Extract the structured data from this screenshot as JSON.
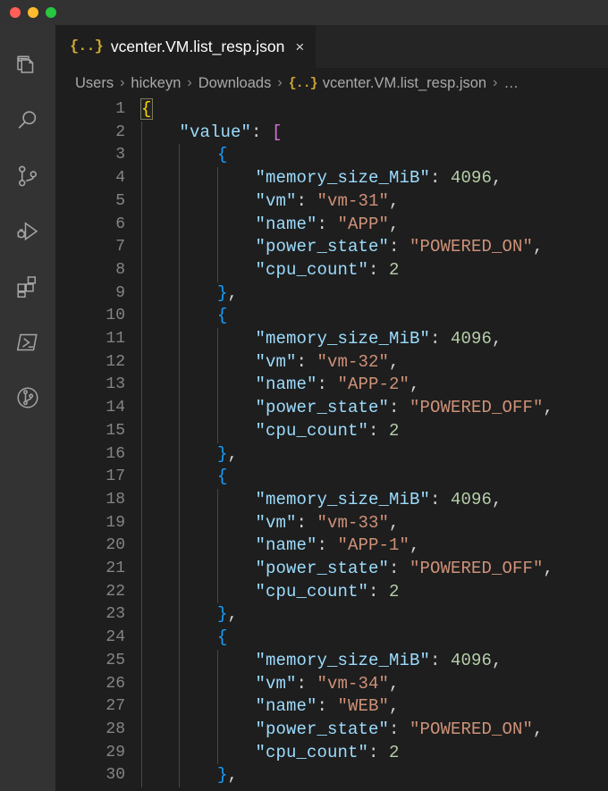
{
  "window": {
    "traffic_lights": [
      {
        "name": "close",
        "color": "#ff5f57"
      },
      {
        "name": "minimize",
        "color": "#febc2e"
      },
      {
        "name": "zoom",
        "color": "#28c840"
      }
    ]
  },
  "activity_bar": {
    "items": [
      {
        "icon": "explorer-icon",
        "label": "Explorer"
      },
      {
        "icon": "search-icon",
        "label": "Search"
      },
      {
        "icon": "source-control-icon",
        "label": "Source Control"
      },
      {
        "icon": "run-and-debug-icon",
        "label": "Run and Debug"
      },
      {
        "icon": "extensions-icon",
        "label": "Extensions"
      },
      {
        "icon": "powershell-icon",
        "label": "PowerShell"
      },
      {
        "icon": "git-graph-icon",
        "label": "Git Graph"
      }
    ]
  },
  "tab": {
    "icon": "{..}",
    "label": "vcenter.VM.list_resp.json",
    "close": "×"
  },
  "breadcrumb": {
    "separator": "›",
    "json_icon": "{..}",
    "items": [
      "Users",
      "hickeyn",
      "Downloads",
      "vcenter.VM.list_resp.json",
      "…"
    ]
  },
  "editor": {
    "language": "json",
    "file_name": "vcenter.VM.list_resp.json",
    "first_line": 1,
    "last_line": 30,
    "total_visible_lines": 30,
    "colors": {
      "background": "#1e1e1e",
      "key": "#9cdcfe",
      "string": "#ce9178",
      "number": "#b5cea8",
      "punctuation": "#d4d4d4",
      "bracket_level_0": "#ffd700",
      "bracket_level_1": "#da70d6",
      "bracket_level_2": "#179fff",
      "line_number": "#858585",
      "indent_guide": "#474747"
    },
    "lines": [
      {
        "n": 1,
        "indent": 0,
        "tokens": [
          {
            "t": "{",
            "c": "bmatch"
          }
        ]
      },
      {
        "n": 2,
        "indent": 1,
        "tokens": [
          {
            "t": "\"value\"",
            "c": "k"
          },
          {
            "t": ": ",
            "c": "p"
          },
          {
            "t": "[",
            "c": "b1"
          }
        ]
      },
      {
        "n": 3,
        "indent": 2,
        "tokens": [
          {
            "t": "{",
            "c": "b2"
          }
        ]
      },
      {
        "n": 4,
        "indent": 3,
        "tokens": [
          {
            "t": "\"memory_size_MiB\"",
            "c": "k"
          },
          {
            "t": ": ",
            "c": "p"
          },
          {
            "t": "4096",
            "c": "n"
          },
          {
            "t": ",",
            "c": "p"
          }
        ]
      },
      {
        "n": 5,
        "indent": 3,
        "tokens": [
          {
            "t": "\"vm\"",
            "c": "k"
          },
          {
            "t": ": ",
            "c": "p"
          },
          {
            "t": "\"vm-31\"",
            "c": "s"
          },
          {
            "t": ",",
            "c": "p"
          }
        ]
      },
      {
        "n": 6,
        "indent": 3,
        "tokens": [
          {
            "t": "\"name\"",
            "c": "k"
          },
          {
            "t": ": ",
            "c": "p"
          },
          {
            "t": "\"APP\"",
            "c": "s"
          },
          {
            "t": ",",
            "c": "p"
          }
        ]
      },
      {
        "n": 7,
        "indent": 3,
        "tokens": [
          {
            "t": "\"power_state\"",
            "c": "k"
          },
          {
            "t": ": ",
            "c": "p"
          },
          {
            "t": "\"POWERED_ON\"",
            "c": "s"
          },
          {
            "t": ",",
            "c": "p"
          }
        ]
      },
      {
        "n": 8,
        "indent": 3,
        "tokens": [
          {
            "t": "\"cpu_count\"",
            "c": "k"
          },
          {
            "t": ": ",
            "c": "p"
          },
          {
            "t": "2",
            "c": "n"
          }
        ]
      },
      {
        "n": 9,
        "indent": 2,
        "tokens": [
          {
            "t": "}",
            "c": "b2"
          },
          {
            "t": ",",
            "c": "p"
          }
        ]
      },
      {
        "n": 10,
        "indent": 2,
        "tokens": [
          {
            "t": "{",
            "c": "b2"
          }
        ]
      },
      {
        "n": 11,
        "indent": 3,
        "tokens": [
          {
            "t": "\"memory_size_MiB\"",
            "c": "k"
          },
          {
            "t": ": ",
            "c": "p"
          },
          {
            "t": "4096",
            "c": "n"
          },
          {
            "t": ",",
            "c": "p"
          }
        ]
      },
      {
        "n": 12,
        "indent": 3,
        "tokens": [
          {
            "t": "\"vm\"",
            "c": "k"
          },
          {
            "t": ": ",
            "c": "p"
          },
          {
            "t": "\"vm-32\"",
            "c": "s"
          },
          {
            "t": ",",
            "c": "p"
          }
        ]
      },
      {
        "n": 13,
        "indent": 3,
        "tokens": [
          {
            "t": "\"name\"",
            "c": "k"
          },
          {
            "t": ": ",
            "c": "p"
          },
          {
            "t": "\"APP-2\"",
            "c": "s"
          },
          {
            "t": ",",
            "c": "p"
          }
        ]
      },
      {
        "n": 14,
        "indent": 3,
        "tokens": [
          {
            "t": "\"power_state\"",
            "c": "k"
          },
          {
            "t": ": ",
            "c": "p"
          },
          {
            "t": "\"POWERED_OFF\"",
            "c": "s"
          },
          {
            "t": ",",
            "c": "p"
          }
        ]
      },
      {
        "n": 15,
        "indent": 3,
        "tokens": [
          {
            "t": "\"cpu_count\"",
            "c": "k"
          },
          {
            "t": ": ",
            "c": "p"
          },
          {
            "t": "2",
            "c": "n"
          }
        ]
      },
      {
        "n": 16,
        "indent": 2,
        "tokens": [
          {
            "t": "}",
            "c": "b2"
          },
          {
            "t": ",",
            "c": "p"
          }
        ]
      },
      {
        "n": 17,
        "indent": 2,
        "tokens": [
          {
            "t": "{",
            "c": "b2"
          }
        ]
      },
      {
        "n": 18,
        "indent": 3,
        "tokens": [
          {
            "t": "\"memory_size_MiB\"",
            "c": "k"
          },
          {
            "t": ": ",
            "c": "p"
          },
          {
            "t": "4096",
            "c": "n"
          },
          {
            "t": ",",
            "c": "p"
          }
        ]
      },
      {
        "n": 19,
        "indent": 3,
        "tokens": [
          {
            "t": "\"vm\"",
            "c": "k"
          },
          {
            "t": ": ",
            "c": "p"
          },
          {
            "t": "\"vm-33\"",
            "c": "s"
          },
          {
            "t": ",",
            "c": "p"
          }
        ]
      },
      {
        "n": 20,
        "indent": 3,
        "tokens": [
          {
            "t": "\"name\"",
            "c": "k"
          },
          {
            "t": ": ",
            "c": "p"
          },
          {
            "t": "\"APP-1\"",
            "c": "s"
          },
          {
            "t": ",",
            "c": "p"
          }
        ]
      },
      {
        "n": 21,
        "indent": 3,
        "tokens": [
          {
            "t": "\"power_state\"",
            "c": "k"
          },
          {
            "t": ": ",
            "c": "p"
          },
          {
            "t": "\"POWERED_OFF\"",
            "c": "s"
          },
          {
            "t": ",",
            "c": "p"
          }
        ]
      },
      {
        "n": 22,
        "indent": 3,
        "tokens": [
          {
            "t": "\"cpu_count\"",
            "c": "k"
          },
          {
            "t": ": ",
            "c": "p"
          },
          {
            "t": "2",
            "c": "n"
          }
        ]
      },
      {
        "n": 23,
        "indent": 2,
        "tokens": [
          {
            "t": "}",
            "c": "b2"
          },
          {
            "t": ",",
            "c": "p"
          }
        ]
      },
      {
        "n": 24,
        "indent": 2,
        "tokens": [
          {
            "t": "{",
            "c": "b2"
          }
        ]
      },
      {
        "n": 25,
        "indent": 3,
        "tokens": [
          {
            "t": "\"memory_size_MiB\"",
            "c": "k"
          },
          {
            "t": ": ",
            "c": "p"
          },
          {
            "t": "4096",
            "c": "n"
          },
          {
            "t": ",",
            "c": "p"
          }
        ]
      },
      {
        "n": 26,
        "indent": 3,
        "tokens": [
          {
            "t": "\"vm\"",
            "c": "k"
          },
          {
            "t": ": ",
            "c": "p"
          },
          {
            "t": "\"vm-34\"",
            "c": "s"
          },
          {
            "t": ",",
            "c": "p"
          }
        ]
      },
      {
        "n": 27,
        "indent": 3,
        "tokens": [
          {
            "t": "\"name\"",
            "c": "k"
          },
          {
            "t": ": ",
            "c": "p"
          },
          {
            "t": "\"WEB\"",
            "c": "s"
          },
          {
            "t": ",",
            "c": "p"
          }
        ]
      },
      {
        "n": 28,
        "indent": 3,
        "tokens": [
          {
            "t": "\"power_state\"",
            "c": "k"
          },
          {
            "t": ": ",
            "c": "p"
          },
          {
            "t": "\"POWERED_ON\"",
            "c": "s"
          },
          {
            "t": ",",
            "c": "p"
          }
        ]
      },
      {
        "n": 29,
        "indent": 3,
        "tokens": [
          {
            "t": "\"cpu_count\"",
            "c": "k"
          },
          {
            "t": ": ",
            "c": "p"
          },
          {
            "t": "2",
            "c": "n"
          }
        ]
      },
      {
        "n": 30,
        "indent": 2,
        "tokens": [
          {
            "t": "}",
            "c": "b2"
          },
          {
            "t": ",",
            "c": "p"
          }
        ]
      }
    ],
    "json_content": {
      "value": [
        {
          "memory_size_MiB": 4096,
          "vm": "vm-31",
          "name": "APP",
          "power_state": "POWERED_ON",
          "cpu_count": 2
        },
        {
          "memory_size_MiB": 4096,
          "vm": "vm-32",
          "name": "APP-2",
          "power_state": "POWERED_OFF",
          "cpu_count": 2
        },
        {
          "memory_size_MiB": 4096,
          "vm": "vm-33",
          "name": "APP-1",
          "power_state": "POWERED_OFF",
          "cpu_count": 2
        },
        {
          "memory_size_MiB": 4096,
          "vm": "vm-34",
          "name": "WEB",
          "power_state": "POWERED_ON",
          "cpu_count": 2
        }
      ]
    }
  }
}
